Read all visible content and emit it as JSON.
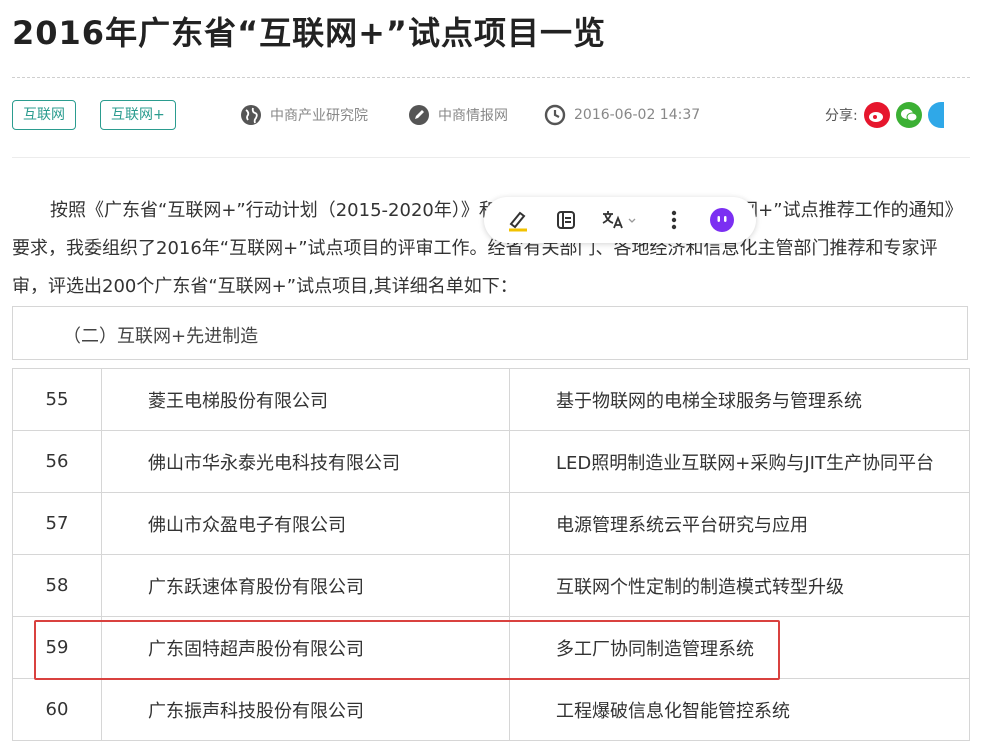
{
  "article": {
    "title": "2016年广东省“互联网+”试点项目一览",
    "tags": [
      "互联网",
      "互联网+"
    ],
    "source1": "中商产业研究院",
    "source2": "中商情报网",
    "datetime": "2016-06-02 14:37",
    "share_label": "分享:",
    "share_icons": [
      "weibo-icon",
      "wechat-icon",
      "qq-icon"
    ],
    "paragraph": "按照《广东省“互联网+”行动计划（2015-2020年）》和广东省经信化委关于开展“互联网+”试点推荐工作的通知》要求，我委组织了2016年“互联网+”试点项目的评审工作。经省有关部门、各地经济和信息化主管部门推荐和专家评审，评选出200个广东省“互联网+”试点项目,其详细名单如下：",
    "section_heading": "（二）互联网+先进制造",
    "rows": [
      {
        "num": "55",
        "company": "菱王电梯股份有限公司",
        "project": "基于物联网的电梯全球服务与管理系统"
      },
      {
        "num": "56",
        "company": "佛山市华永泰光电科技有限公司",
        "project": "LED照明制造业互联网+采购与JIT生产协同平台"
      },
      {
        "num": "57",
        "company": "佛山市众盈电子有限公司",
        "project": "电源管理系统云平台研究与应用"
      },
      {
        "num": "58",
        "company": "广东跃速体育股份有限公司",
        "project": "互联网个性定制的制造模式转型升级"
      },
      {
        "num": "59",
        "company": "广东固特超声股份有限公司",
        "project": "多工厂协同制造管理系统"
      },
      {
        "num": "60",
        "company": "广东振声科技股份有限公司",
        "project": "工程爆破信息化智能管控系统"
      }
    ]
  },
  "toolbar": {
    "buttons": [
      "highlight-icon",
      "note-icon",
      "translate-icon",
      "more-icon",
      "assistant-icon"
    ]
  },
  "colors": {
    "tag": "#2b9c8f",
    "highlight_box": "#d9413f",
    "weibo": "#e6162d",
    "wechat": "#3cb034",
    "qq": "#2fa8e8",
    "assistant": "#7b2ff2"
  }
}
